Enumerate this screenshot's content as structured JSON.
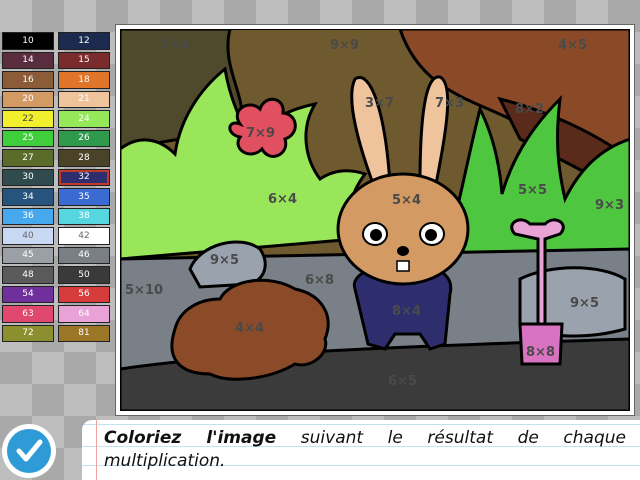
{
  "palette": [
    {
      "label": "10",
      "color": "#000000",
      "text": "#ffffff"
    },
    {
      "label": "12",
      "color": "#1c2a4f",
      "text": "#ffffff"
    },
    {
      "label": "14",
      "color": "#5a2d3e",
      "text": "#ffffff"
    },
    {
      "label": "15",
      "color": "#7a2b2b",
      "text": "#ffffff"
    },
    {
      "label": "16",
      "color": "#8b5c37",
      "text": "#ffffff"
    },
    {
      "label": "18",
      "color": "#e07428",
      "text": "#ffffff"
    },
    {
      "label": "20",
      "color": "#d49a64",
      "text": "#ffffff"
    },
    {
      "label": "21",
      "color": "#efc49d",
      "text": "#ffffff"
    },
    {
      "label": "22",
      "color": "#f1ef2e",
      "text": "#444444"
    },
    {
      "label": "24",
      "color": "#95e85a",
      "text": "#ffffff"
    },
    {
      "label": "25",
      "color": "#3fcf3c",
      "text": "#ffffff"
    },
    {
      "label": "26",
      "color": "#2f9a4c",
      "text": "#ffffff"
    },
    {
      "label": "27",
      "color": "#5b6b2a",
      "text": "#ffffff"
    },
    {
      "label": "28",
      "color": "#4a4327",
      "text": "#ffffff"
    },
    {
      "label": "30",
      "color": "#2f4b4d",
      "text": "#ffffff"
    },
    {
      "label": "32",
      "color": "#2e2e6e",
      "text": "#ffffff"
    },
    {
      "label": "34",
      "color": "#27547e",
      "text": "#ffffff"
    },
    {
      "label": "35",
      "color": "#3a6bd2",
      "text": "#ffffff"
    },
    {
      "label": "36",
      "color": "#46a9ee",
      "text": "#ffffff"
    },
    {
      "label": "38",
      "color": "#56d6de",
      "text": "#ffffff"
    },
    {
      "label": "40",
      "color": "#c9d9f4",
      "text": "#666666"
    },
    {
      "label": "42",
      "color": "#ffffff",
      "text": "#666666"
    },
    {
      "label": "45",
      "color": "#9aa0a6",
      "text": "#ffffff"
    },
    {
      "label": "46",
      "color": "#7a7f85",
      "text": "#ffffff"
    },
    {
      "label": "48",
      "color": "#5a5a5a",
      "text": "#ffffff"
    },
    {
      "label": "50",
      "color": "#3a3a3a",
      "text": "#ffffff"
    },
    {
      "label": "54",
      "color": "#6f2f9c",
      "text": "#ffffff"
    },
    {
      "label": "56",
      "color": "#d73c3c",
      "text": "#ffffff"
    },
    {
      "label": "63",
      "color": "#e0486e",
      "text": "#ffffff"
    },
    {
      "label": "64",
      "color": "#e9a2d6",
      "text": "#ffffff"
    },
    {
      "label": "72",
      "color": "#8c8f2e",
      "text": "#ffffff"
    },
    {
      "label": "81",
      "color": "#9c7627",
      "text": "#ffffff"
    }
  ],
  "selected_color": "32",
  "picture": {
    "bg_top_left": "7×4",
    "bg_top_mid": "9×9",
    "bg_top_right": "4×5",
    "ear_left": "3×7",
    "ear_right": "7×3",
    "mound": "8×2",
    "flower": "7×9",
    "grass_right": "5×5",
    "right_dark": "9×3",
    "head": "5×4",
    "bush_left": "6×4",
    "rock": "9×5",
    "stones": "6×8",
    "ground_left": "5×10",
    "body": "8×4",
    "stone_right": "9×5",
    "dirt": "4×4",
    "shovel": "8×8",
    "ground": "6×5"
  },
  "instruction": {
    "bold": "Coloriez l'image",
    "rest": " suivant le résultat de chaque multiplication."
  },
  "icons": {
    "validate": "check-icon"
  }
}
